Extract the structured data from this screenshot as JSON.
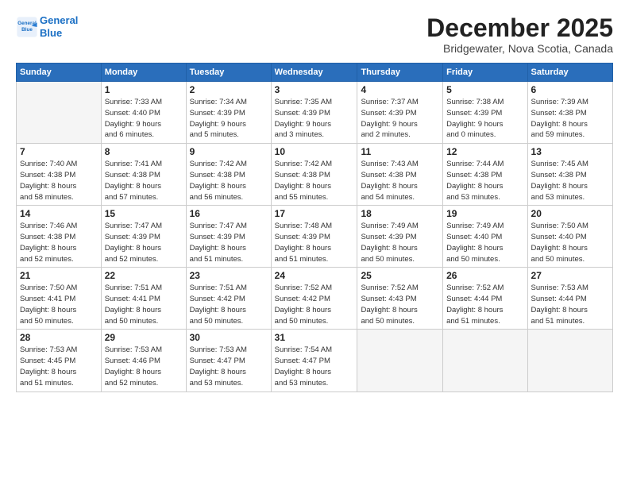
{
  "logo": {
    "line1": "General",
    "line2": "Blue"
  },
  "title": "December 2025",
  "subtitle": "Bridgewater, Nova Scotia, Canada",
  "days_of_week": [
    "Sunday",
    "Monday",
    "Tuesday",
    "Wednesday",
    "Thursday",
    "Friday",
    "Saturday"
  ],
  "weeks": [
    [
      {
        "day": "",
        "info": ""
      },
      {
        "day": "1",
        "info": "Sunrise: 7:33 AM\nSunset: 4:40 PM\nDaylight: 9 hours\nand 6 minutes."
      },
      {
        "day": "2",
        "info": "Sunrise: 7:34 AM\nSunset: 4:39 PM\nDaylight: 9 hours\nand 5 minutes."
      },
      {
        "day": "3",
        "info": "Sunrise: 7:35 AM\nSunset: 4:39 PM\nDaylight: 9 hours\nand 3 minutes."
      },
      {
        "day": "4",
        "info": "Sunrise: 7:37 AM\nSunset: 4:39 PM\nDaylight: 9 hours\nand 2 minutes."
      },
      {
        "day": "5",
        "info": "Sunrise: 7:38 AM\nSunset: 4:39 PM\nDaylight: 9 hours\nand 0 minutes."
      },
      {
        "day": "6",
        "info": "Sunrise: 7:39 AM\nSunset: 4:38 PM\nDaylight: 8 hours\nand 59 minutes."
      }
    ],
    [
      {
        "day": "7",
        "info": "Sunrise: 7:40 AM\nSunset: 4:38 PM\nDaylight: 8 hours\nand 58 minutes."
      },
      {
        "day": "8",
        "info": "Sunrise: 7:41 AM\nSunset: 4:38 PM\nDaylight: 8 hours\nand 57 minutes."
      },
      {
        "day": "9",
        "info": "Sunrise: 7:42 AM\nSunset: 4:38 PM\nDaylight: 8 hours\nand 56 minutes."
      },
      {
        "day": "10",
        "info": "Sunrise: 7:42 AM\nSunset: 4:38 PM\nDaylight: 8 hours\nand 55 minutes."
      },
      {
        "day": "11",
        "info": "Sunrise: 7:43 AM\nSunset: 4:38 PM\nDaylight: 8 hours\nand 54 minutes."
      },
      {
        "day": "12",
        "info": "Sunrise: 7:44 AM\nSunset: 4:38 PM\nDaylight: 8 hours\nand 53 minutes."
      },
      {
        "day": "13",
        "info": "Sunrise: 7:45 AM\nSunset: 4:38 PM\nDaylight: 8 hours\nand 53 minutes."
      }
    ],
    [
      {
        "day": "14",
        "info": "Sunrise: 7:46 AM\nSunset: 4:38 PM\nDaylight: 8 hours\nand 52 minutes."
      },
      {
        "day": "15",
        "info": "Sunrise: 7:47 AM\nSunset: 4:39 PM\nDaylight: 8 hours\nand 52 minutes."
      },
      {
        "day": "16",
        "info": "Sunrise: 7:47 AM\nSunset: 4:39 PM\nDaylight: 8 hours\nand 51 minutes."
      },
      {
        "day": "17",
        "info": "Sunrise: 7:48 AM\nSunset: 4:39 PM\nDaylight: 8 hours\nand 51 minutes."
      },
      {
        "day": "18",
        "info": "Sunrise: 7:49 AM\nSunset: 4:39 PM\nDaylight: 8 hours\nand 50 minutes."
      },
      {
        "day": "19",
        "info": "Sunrise: 7:49 AM\nSunset: 4:40 PM\nDaylight: 8 hours\nand 50 minutes."
      },
      {
        "day": "20",
        "info": "Sunrise: 7:50 AM\nSunset: 4:40 PM\nDaylight: 8 hours\nand 50 minutes."
      }
    ],
    [
      {
        "day": "21",
        "info": "Sunrise: 7:50 AM\nSunset: 4:41 PM\nDaylight: 8 hours\nand 50 minutes."
      },
      {
        "day": "22",
        "info": "Sunrise: 7:51 AM\nSunset: 4:41 PM\nDaylight: 8 hours\nand 50 minutes."
      },
      {
        "day": "23",
        "info": "Sunrise: 7:51 AM\nSunset: 4:42 PM\nDaylight: 8 hours\nand 50 minutes."
      },
      {
        "day": "24",
        "info": "Sunrise: 7:52 AM\nSunset: 4:42 PM\nDaylight: 8 hours\nand 50 minutes."
      },
      {
        "day": "25",
        "info": "Sunrise: 7:52 AM\nSunset: 4:43 PM\nDaylight: 8 hours\nand 50 minutes."
      },
      {
        "day": "26",
        "info": "Sunrise: 7:52 AM\nSunset: 4:44 PM\nDaylight: 8 hours\nand 51 minutes."
      },
      {
        "day": "27",
        "info": "Sunrise: 7:53 AM\nSunset: 4:44 PM\nDaylight: 8 hours\nand 51 minutes."
      }
    ],
    [
      {
        "day": "28",
        "info": "Sunrise: 7:53 AM\nSunset: 4:45 PM\nDaylight: 8 hours\nand 51 minutes."
      },
      {
        "day": "29",
        "info": "Sunrise: 7:53 AM\nSunset: 4:46 PM\nDaylight: 8 hours\nand 52 minutes."
      },
      {
        "day": "30",
        "info": "Sunrise: 7:53 AM\nSunset: 4:47 PM\nDaylight: 8 hours\nand 53 minutes."
      },
      {
        "day": "31",
        "info": "Sunrise: 7:54 AM\nSunset: 4:47 PM\nDaylight: 8 hours\nand 53 minutes."
      },
      {
        "day": "",
        "info": ""
      },
      {
        "day": "",
        "info": ""
      },
      {
        "day": "",
        "info": ""
      }
    ]
  ]
}
